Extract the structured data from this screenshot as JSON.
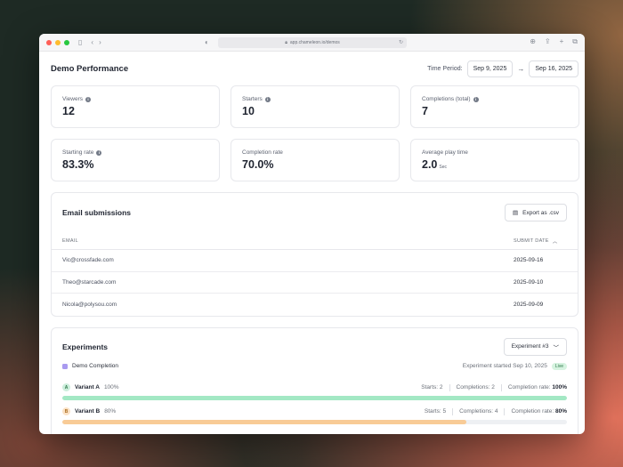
{
  "browser": {
    "url": "app.chameleon.io/demos"
  },
  "page": {
    "title": "Demo Performance",
    "period_label": "Time Period:",
    "start_date": "Sep 9, 2025",
    "end_date": "Sep 16, 2025"
  },
  "stats": [
    {
      "label": "Viewers",
      "value": "12",
      "info": true
    },
    {
      "label": "Starters",
      "value": "10",
      "info": true
    },
    {
      "label": "Completions (total)",
      "value": "7",
      "info": true
    },
    {
      "label": "Starting rate",
      "value": "83.3%",
      "info": true
    },
    {
      "label": "Completion rate",
      "value": "70.0%",
      "info": false
    },
    {
      "label": "Average play time",
      "value": "2.0",
      "unit": "Sec",
      "info": false
    }
  ],
  "emails": {
    "title": "Email submissions",
    "export_label": "Export as .csv",
    "col_email": "EMAIL",
    "col_date": "SUBMIT DATE",
    "rows": [
      {
        "email": "Vic@crossfade.com",
        "date": "2025-09-16"
      },
      {
        "email": "Theo@starcade.com",
        "date": "2025-09-10"
      },
      {
        "email": "Nicola@polysou.com",
        "date": "2025-09-09"
      }
    ]
  },
  "experiments": {
    "title": "Experiments",
    "selector": "Experiment #3",
    "name": "Demo Completion",
    "started": "Experiment started Sep 10, 2025",
    "status": "Live",
    "variants": [
      {
        "badge": "A",
        "name": "Variant A",
        "pct": "100%",
        "starts": "Starts: 2",
        "completions": "Completions: 2",
        "rate_label": "Completion rate:",
        "rate": "100%",
        "fill": 1.0,
        "color": "#a3e8c4"
      },
      {
        "badge": "B",
        "name": "Variant B",
        "pct": "80%",
        "starts": "Starts: 5",
        "completions": "Completions: 4",
        "rate_label": "Completion rate:",
        "rate": "80%",
        "fill": 0.8,
        "color": "#f8cb96"
      }
    ]
  }
}
